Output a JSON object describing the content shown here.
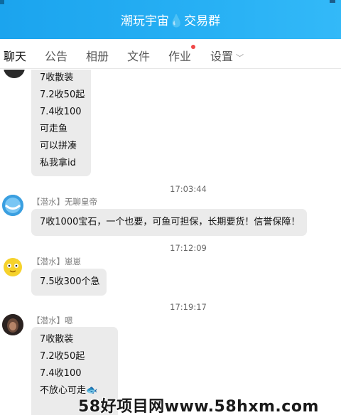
{
  "window": {
    "title": "潮玩宇宙💧交易群"
  },
  "tabs": [
    {
      "label": "聊天",
      "active": true
    },
    {
      "label": "公告",
      "active": false
    },
    {
      "label": "相册",
      "active": false
    },
    {
      "label": "文件",
      "active": false
    },
    {
      "label": "作业",
      "active": false,
      "badge_dot": true
    },
    {
      "label": "设置",
      "active": false,
      "dropdown": "chevron-down-icon"
    }
  ],
  "messages": [
    {
      "lines": [
        "7收散装",
        "7.2收50起",
        "7.4收100",
        "可走鱼",
        "可以拼凑",
        "私我拿id"
      ]
    },
    {
      "time": "17:03:44",
      "role": "【潜水】",
      "name": "无聊皇帝",
      "lines": [
        "7收1000宝石，一个也要，可鱼可担保，长期要货！信誉保障！"
      ]
    },
    {
      "time": "17:12:09",
      "role": "【潜水】",
      "name": "崽崽",
      "lines": [
        "7.5收300个急"
      ]
    },
    {
      "time": "17:19:17",
      "role": "【潜水】",
      "name": "嗯",
      "lines": [
        "7收散装",
        "7.2收50起",
        "7.4收100",
        "不放心可走🐟"
      ]
    }
  ],
  "watermark": "58好项目网www.58hxm.com",
  "colors": {
    "titlebar": "#27b0f4",
    "tab_underline": "#2aa5f0",
    "bubble": "#ebebeb",
    "badge": "#f04848"
  }
}
